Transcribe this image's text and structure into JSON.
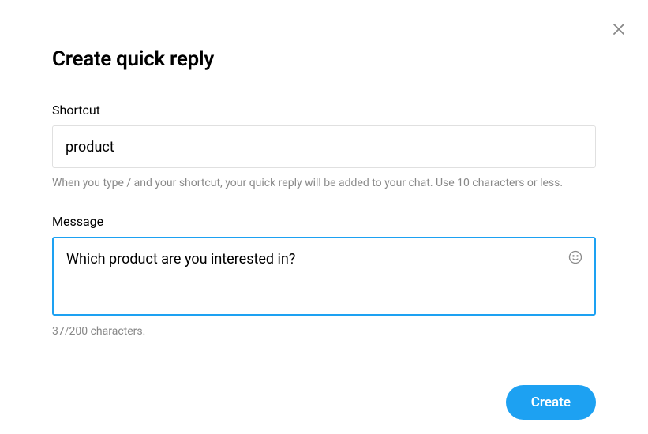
{
  "dialog": {
    "title": "Create quick reply"
  },
  "shortcut": {
    "label": "Shortcut",
    "value": "product",
    "helper": "When you type / and your shortcut, your quick reply will be added to your chat. Use 10 characters or less."
  },
  "message": {
    "label": "Message",
    "value": "Which product are you interested in?",
    "char_count": "37/200 characters."
  },
  "footer": {
    "create_label": "Create"
  }
}
